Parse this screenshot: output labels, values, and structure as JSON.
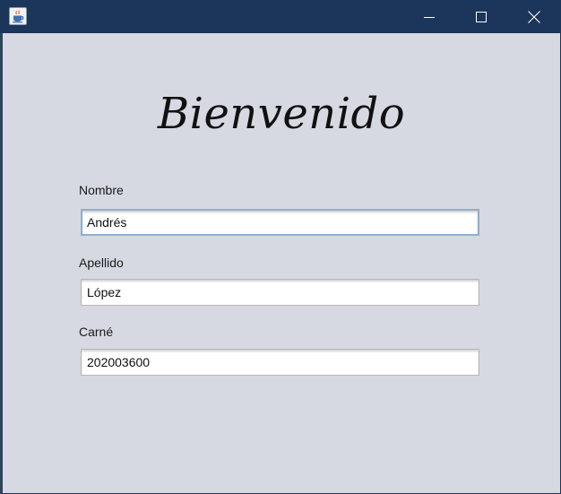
{
  "window": {
    "icon": "java-cup-icon",
    "controls": {
      "minimize": "minimize-icon",
      "maximize": "maximize-icon",
      "close": "close-icon"
    }
  },
  "form": {
    "heading": "Bienvenido",
    "fields": [
      {
        "label": "Nombre",
        "value": "Andrés",
        "focused": true
      },
      {
        "label": "Apellido",
        "value": "López",
        "focused": false
      },
      {
        "label": "Carné",
        "value": "202003600",
        "focused": false
      }
    ]
  },
  "colors": {
    "titlebar": "#1c355a",
    "background": "#d6d9e1",
    "focus_border": "#8fb0cf"
  }
}
